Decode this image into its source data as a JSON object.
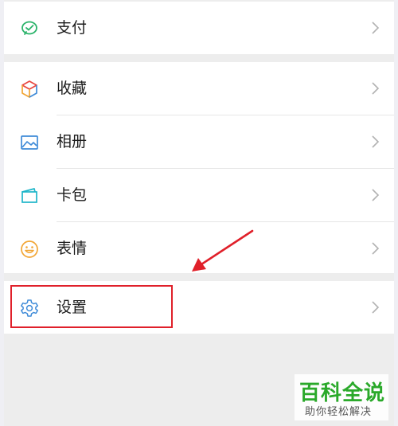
{
  "menu": {
    "items": [
      {
        "label": "支付",
        "icon": "wechat-pay-icon"
      },
      {
        "label": "收藏",
        "icon": "favorites-cube-icon"
      },
      {
        "label": "相册",
        "icon": "album-image-icon"
      },
      {
        "label": "卡包",
        "icon": "card-wallet-icon"
      },
      {
        "label": "表情",
        "icon": "smiley-emoji-icon"
      },
      {
        "label": "设置",
        "icon": "gear-icon"
      }
    ]
  },
  "annotation": {
    "highlight_color": "#e0202a",
    "arrow_color": "#e0202a",
    "highlighted_item": "设置"
  },
  "watermark": {
    "title": "百科全说",
    "subtitle": "助你轻松解决"
  },
  "colors": {
    "background": "#ededed",
    "row": "#ffffff",
    "text": "#1a1a1a",
    "chevron": "#b2b2b2",
    "pay_green": "#2bb36a",
    "blue_icon": "#3f8bd8",
    "teal_icon": "#1fb6c9",
    "emoji_orange": "#f2a533",
    "watermark_green": "#2aa92a"
  }
}
